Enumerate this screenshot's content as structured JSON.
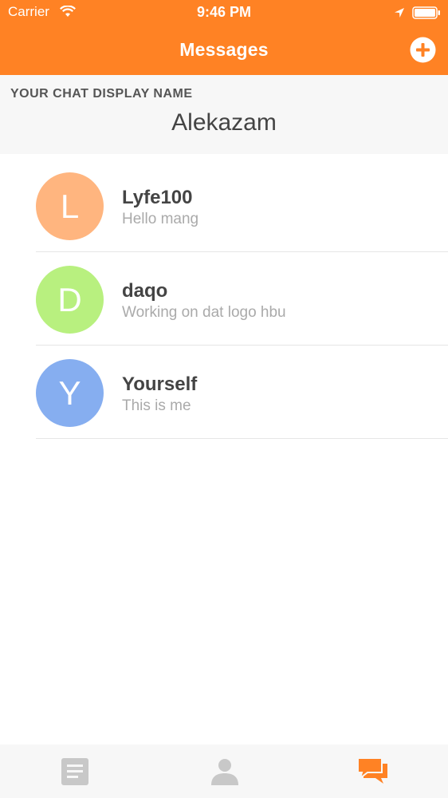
{
  "status_bar": {
    "carrier": "Carrier",
    "time": "9:46 PM"
  },
  "nav": {
    "title": "Messages",
    "add_icon": "plus-circle-icon"
  },
  "display_name": {
    "label": "YOUR CHAT DISPLAY NAME",
    "value": "Alekazam"
  },
  "chats": [
    {
      "initial": "L",
      "name": "Lyfe100",
      "preview": "Hello mang",
      "color": "#ffb57f"
    },
    {
      "initial": "D",
      "name": "daqo",
      "preview": "Working on dat logo hbu",
      "color": "#b8f07f"
    },
    {
      "initial": "Y",
      "name": "Yourself",
      "preview": "This is me",
      "color": "#86aef0"
    }
  ],
  "tabs": [
    {
      "icon": "document-icon",
      "active": false
    },
    {
      "icon": "person-icon",
      "active": false
    },
    {
      "icon": "chat-bubbles-icon",
      "active": true
    }
  ],
  "colors": {
    "accent": "#ff8224",
    "inactive_tab": "#c8c8c8"
  }
}
